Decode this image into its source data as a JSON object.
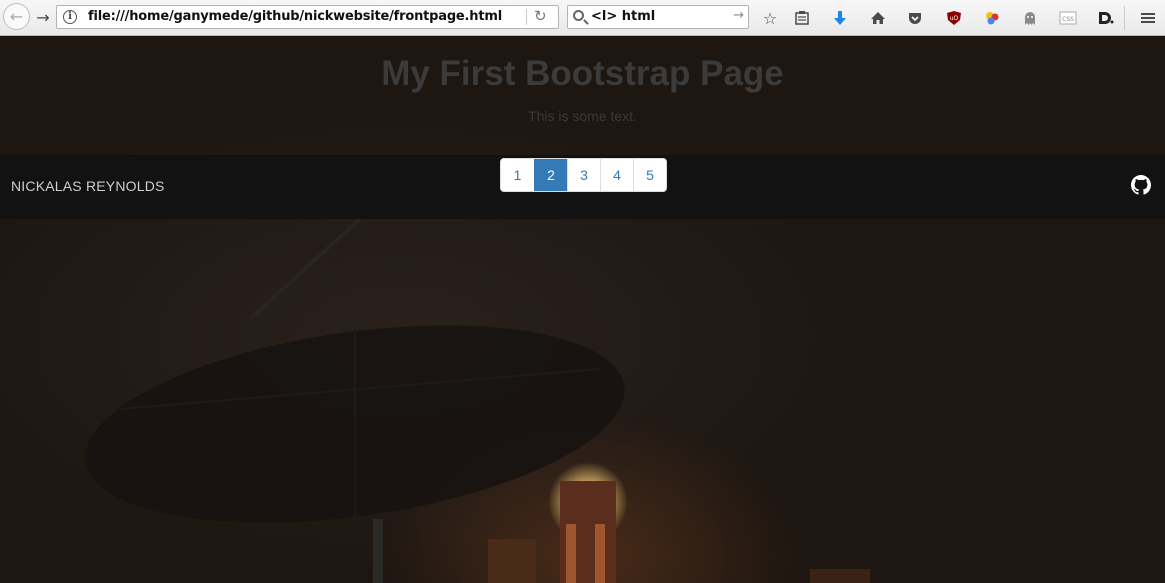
{
  "browser": {
    "url": "file:///home/ganymede/github/nickwebsite/frontpage.html",
    "search_value": "<l> html",
    "icons": [
      "back-icon",
      "forward-icon",
      "info-icon",
      "reload-icon",
      "search-icon",
      "search-go-icon",
      "bookmark-star-icon",
      "reader-list-icon",
      "download-icon",
      "home-icon",
      "pocket-icon",
      "ublock-icon",
      "extension-icon",
      "ghostery-icon",
      "css-icon",
      "dashlane-icon",
      "menu-icon"
    ]
  },
  "page": {
    "title": "My First Bootstrap Page",
    "subtitle": "This is some text.",
    "brand": "NICKALAS REYNOLDS",
    "pagination": [
      "1",
      "2",
      "3",
      "4",
      "5"
    ],
    "active_page": "2"
  },
  "colors": {
    "link": "#337ab7",
    "navbar_bg": "#121212",
    "title": "#3b3b3b"
  }
}
